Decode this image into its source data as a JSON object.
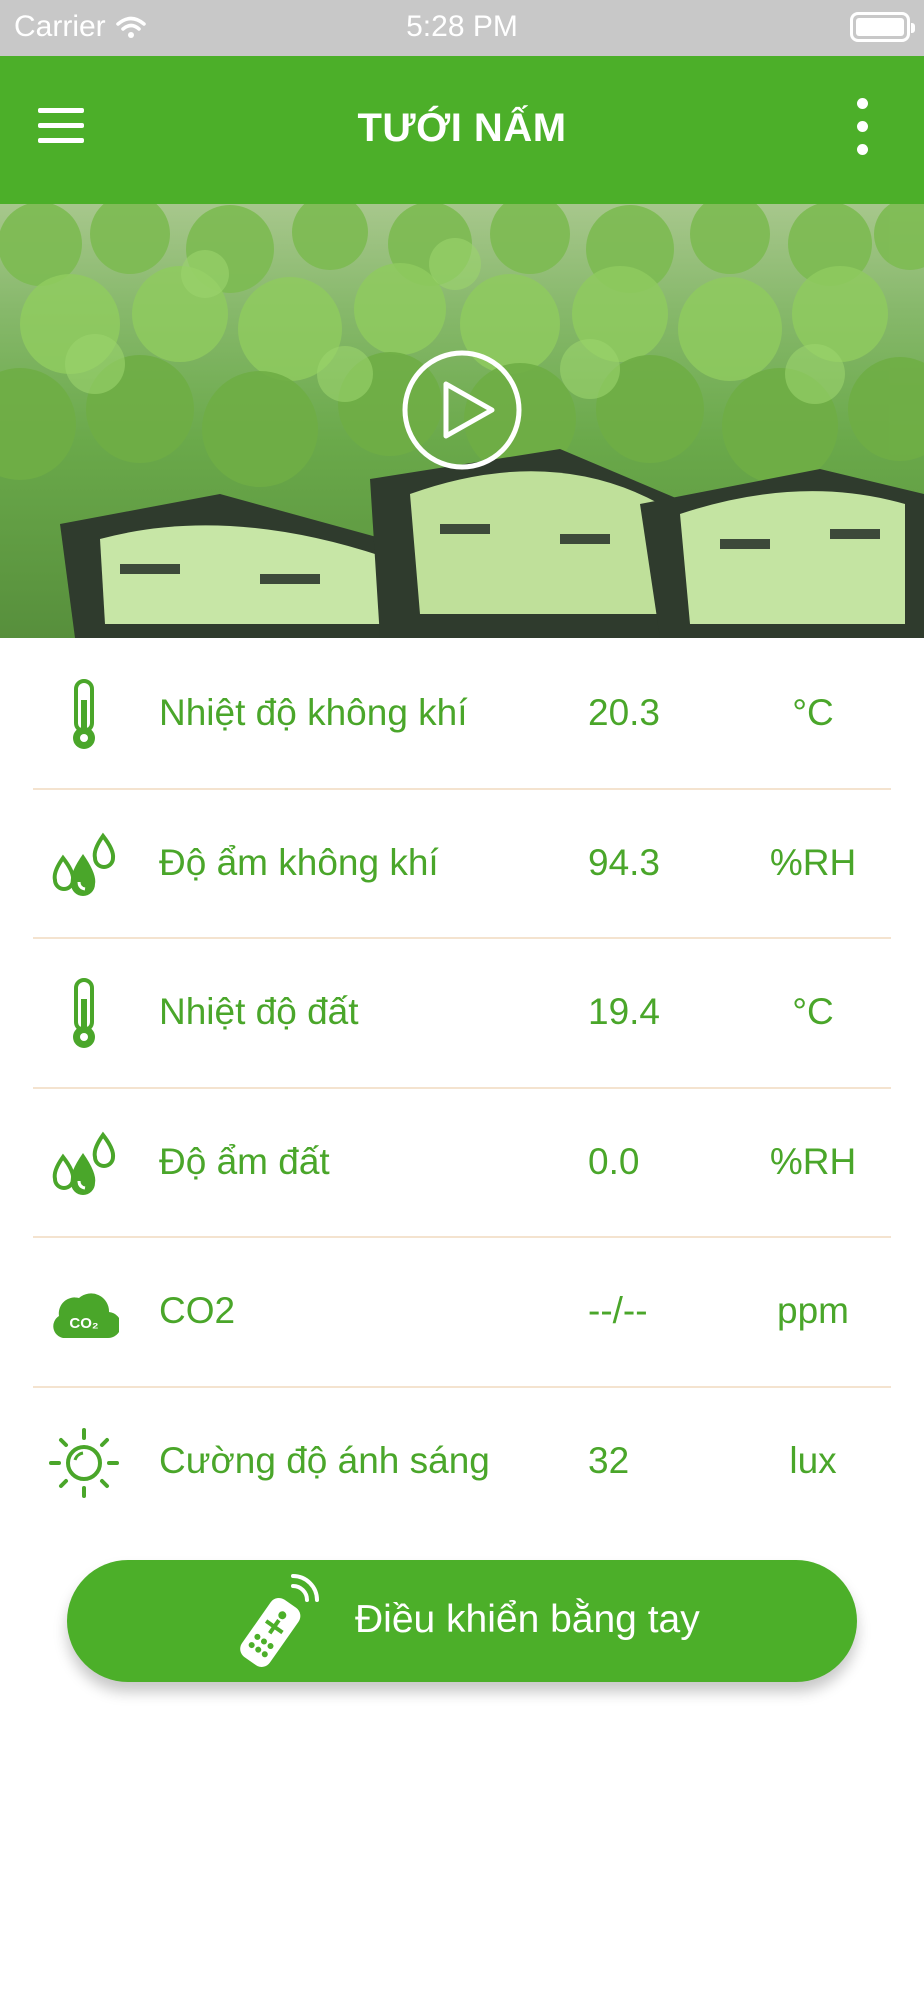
{
  "status_bar": {
    "carrier": "Carrier",
    "time": "5:28 PM"
  },
  "header": {
    "title": "TƯỚI NẤM",
    "menu_icon": "hamburger-menu-icon",
    "more_icon": "vertical-dots-icon"
  },
  "hero": {
    "image": "lettuce-field-crates",
    "play_icon": "play-icon"
  },
  "sensors": [
    {
      "icon": "thermometer-icon",
      "label": "Nhiệt độ không khí",
      "value": "20.3",
      "unit": "°C"
    },
    {
      "icon": "water-drops-icon",
      "label": "Độ ẩm không khí",
      "value": "94.3",
      "unit": "%RH"
    },
    {
      "icon": "thermometer-icon",
      "label": "Nhiệt độ đất",
      "value": "19.4",
      "unit": "°C"
    },
    {
      "icon": "water-drops-icon",
      "label": "Độ ẩm đất",
      "value": "0.0",
      "unit": "%RH"
    },
    {
      "icon": "co2-cloud-icon",
      "label": "CO2",
      "value": "--/--",
      "unit": "ppm"
    },
    {
      "icon": "sun-icon",
      "label": "Cường độ ánh sáng",
      "value": "32",
      "unit": "lux"
    }
  ],
  "manual_control": {
    "label": "Điều khiển bằng tay",
    "icon": "remote-control-icon"
  },
  "colors": {
    "primary_green": "#4caf29",
    "text_green": "#4aa62a",
    "divider": "#f4e3cf",
    "status_bar_bg": "#c8c8c8"
  }
}
